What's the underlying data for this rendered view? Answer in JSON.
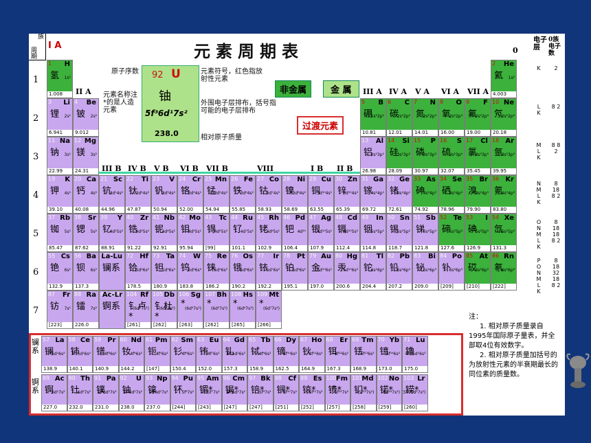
{
  "page": {
    "title": "元素周期表",
    "corner_top": "族",
    "corner_bottom": "周期",
    "group_1a": "I A",
    "group_0": "0",
    "shell_header": "电子层",
    "shell_count_header": "0族电子数"
  },
  "groups_top": [
    "II A",
    "III A",
    "IV A",
    "V A",
    "VI A",
    "VII A"
  ],
  "groups_b": [
    "III B",
    "IV B",
    "V B",
    "VI B",
    "VII B",
    "VIII",
    "I B",
    "II B"
  ],
  "periods": [
    "1",
    "2",
    "3",
    "4",
    "5",
    "6",
    "7"
  ],
  "legend": {
    "z": "92",
    "symbol": "U",
    "name": "铀",
    "config": "5f³6d¹7s²",
    "mass": "238.0",
    "label_z": "原子序数",
    "label_symbol": "元素符号，红色指放射性元素",
    "label_name": "元素名称注*的是人造元素",
    "label_config": "外围电子层排布，括号指可能的电子层排布",
    "label_mass": "相对原子质量",
    "nonmetal": "非金属",
    "metal": "金 属",
    "transition": "过渡元素"
  },
  "lanthanide_row_label": "镧系",
  "actinide_row_label": "锕系",
  "note": {
    "head": "注：",
    "line1": "1. 相对原子质量录自1995年国际原子量表，并全部取4位有效数字。",
    "line2": "2. 相对原子质量加括号的为放射性元素的半衰期最长的同位素的质量数。"
  },
  "shells": [
    {
      "letters": "K",
      "counts": "2"
    },
    {
      "letters": "L K",
      "counts": "8 2"
    },
    {
      "letters": "M L K",
      "counts": "8 8 2"
    },
    {
      "letters": "N M L K",
      "counts": "8 18 8 2"
    },
    {
      "letters": "O N M L K",
      "counts": "8 18 18 8 2"
    },
    {
      "letters": "P O N M L K",
      "counts": "8 18 32 18 8 2"
    }
  ],
  "elements": [
    {
      "z": "1",
      "s": "H",
      "n": "氢",
      "c": "1s¹",
      "m": "1.008",
      "r": 1,
      "col": 1,
      "nm": true
    },
    {
      "z": "2",
      "s": "He",
      "n": "氦",
      "c": "1s²",
      "m": "4.003",
      "r": 1,
      "col": 18,
      "nm": true
    },
    {
      "z": "3",
      "s": "Li",
      "n": "锂",
      "c": "2s¹",
      "m": "6.941",
      "r": 2,
      "col": 1
    },
    {
      "z": "4",
      "s": "Be",
      "n": "铍",
      "c": "2s²",
      "m": "9.012",
      "r": 2,
      "col": 2
    },
    {
      "z": "5",
      "s": "B",
      "n": "硼",
      "c": "2s²2p¹",
      "m": "10.81",
      "r": 2,
      "col": 13,
      "nm": true
    },
    {
      "z": "6",
      "s": "C",
      "n": "碳",
      "c": "2s²2p²",
      "m": "12.01",
      "r": 2,
      "col": 14,
      "nm": true
    },
    {
      "z": "7",
      "s": "N",
      "n": "氮",
      "c": "2s²2p³",
      "m": "14.01",
      "r": 2,
      "col": 15,
      "nm": true
    },
    {
      "z": "8",
      "s": "O",
      "n": "氧",
      "c": "2s²2p⁴",
      "m": "16.00",
      "r": 2,
      "col": 16,
      "nm": true
    },
    {
      "z": "9",
      "s": "F",
      "n": "氟",
      "c": "2s²2p⁵",
      "m": "19.00",
      "r": 2,
      "col": 17,
      "nm": true
    },
    {
      "z": "10",
      "s": "Ne",
      "n": "氖",
      "c": "2s²2p⁶",
      "m": "20.18",
      "r": 2,
      "col": 18,
      "nm": true
    },
    {
      "z": "11",
      "s": "Na",
      "n": "钠",
      "c": "3s¹",
      "m": "22.99",
      "r": 3,
      "col": 1
    },
    {
      "z": "12",
      "s": "Mg",
      "n": "镁",
      "c": "3s²",
      "m": "24.31",
      "r": 3,
      "col": 2
    },
    {
      "z": "13",
      "s": "Al",
      "n": "铝",
      "c": "3s²3p¹",
      "m": "26.98",
      "r": 3,
      "col": 13
    },
    {
      "z": "14",
      "s": "Si",
      "n": "硅",
      "c": "3s²3p²",
      "m": "28.09",
      "r": 3,
      "col": 14,
      "nm": true
    },
    {
      "z": "15",
      "s": "P",
      "n": "磷",
      "c": "3s²3p³",
      "m": "30.97",
      "r": 3,
      "col": 15,
      "nm": true
    },
    {
      "z": "16",
      "s": "S",
      "n": "硫",
      "c": "3s²3p⁴",
      "m": "32.07",
      "r": 3,
      "col": 16,
      "nm": true
    },
    {
      "z": "17",
      "s": "Cl",
      "n": "氯",
      "c": "3s²3p⁵",
      "m": "35.45",
      "r": 3,
      "col": 17,
      "nm": true
    },
    {
      "z": "18",
      "s": "Ar",
      "n": "氩",
      "c": "3s²3p⁶",
      "m": "39.95",
      "r": 3,
      "col": 18,
      "nm": true
    },
    {
      "z": "19",
      "s": "K",
      "n": "钾",
      "c": "4s¹",
      "m": "39.10",
      "r": 4,
      "col": 1
    },
    {
      "z": "20",
      "s": "Ca",
      "n": "钙",
      "c": "4s²",
      "m": "40.08",
      "r": 4,
      "col": 2
    },
    {
      "z": "21",
      "s": "Sc",
      "n": "钪",
      "c": "3d¹4s²",
      "m": "44.96",
      "r": 4,
      "col": 3
    },
    {
      "z": "22",
      "s": "Ti",
      "n": "钛",
      "c": "3d²4s²",
      "m": "47.87",
      "r": 4,
      "col": 4
    },
    {
      "z": "23",
      "s": "V",
      "n": "钒",
      "c": "3d³4s²",
      "m": "50.94",
      "r": 4,
      "col": 5
    },
    {
      "z": "24",
      "s": "Cr",
      "n": "铬",
      "c": "3d⁵4s¹",
      "m": "52.00",
      "r": 4,
      "col": 6
    },
    {
      "z": "25",
      "s": "Mn",
      "n": "锰",
      "c": "3d⁵4s²",
      "m": "54.94",
      "r": 4,
      "col": 7
    },
    {
      "z": "26",
      "s": "Fe",
      "n": "铁",
      "c": "3d⁶4s²",
      "m": "55.85",
      "r": 4,
      "col": 8
    },
    {
      "z": "27",
      "s": "Co",
      "n": "钴",
      "c": "3d⁷4s²",
      "m": "58.93",
      "r": 4,
      "col": 9
    },
    {
      "z": "28",
      "s": "Ni",
      "n": "镍",
      "c": "3d⁸4s²",
      "m": "58.69",
      "r": 4,
      "col": 10
    },
    {
      "z": "29",
      "s": "Cu",
      "n": "铜",
      "c": "3d¹⁰4s¹",
      "m": "63.55",
      "r": 4,
      "col": 11
    },
    {
      "z": "30",
      "s": "Zn",
      "n": "锌",
      "c": "3d¹⁰4s²",
      "m": "65.39",
      "r": 4,
      "col": 12
    },
    {
      "z": "31",
      "s": "Ga",
      "n": "镓",
      "c": "4s²4p¹",
      "m": "69.72",
      "r": 4,
      "col": 13
    },
    {
      "z": "32",
      "s": "Ge",
      "n": "锗",
      "c": "4s²4p²",
      "m": "72.61",
      "r": 4,
      "col": 14
    },
    {
      "z": "33",
      "s": "As",
      "n": "砷",
      "c": "4s²4p³",
      "m": "74.92",
      "r": 4,
      "col": 15,
      "nm": true
    },
    {
      "z": "34",
      "s": "Se",
      "n": "硒",
      "c": "4s²4p⁴",
      "m": "78.96",
      "r": 4,
      "col": 16,
      "nm": true
    },
    {
      "z": "35",
      "s": "Br",
      "n": "溴",
      "c": "4s²4p⁵",
      "m": "79.90",
      "r": 4,
      "col": 17,
      "nm": true
    },
    {
      "z": "36",
      "s": "Kr",
      "n": "氪",
      "c": "4s²4p⁶",
      "m": "83.80",
      "r": 4,
      "col": 18,
      "nm": true
    },
    {
      "z": "37",
      "s": "Rb",
      "n": "铷",
      "c": "5s¹",
      "m": "85.47",
      "r": 5,
      "col": 1
    },
    {
      "z": "38",
      "s": "Sr",
      "n": "锶",
      "c": "5s²",
      "m": "87.62",
      "r": 5,
      "col": 2
    },
    {
      "z": "39",
      "s": "Y",
      "n": "钇",
      "c": "4d¹5s²",
      "m": "88.91",
      "r": 5,
      "col": 3
    },
    {
      "z": "40",
      "s": "Zr",
      "n": "锆",
      "c": "4d²5s²",
      "m": "91.22",
      "r": 5,
      "col": 4
    },
    {
      "z": "41",
      "s": "Nb",
      "n": "铌",
      "c": "4d⁴5s¹",
      "m": "92.91",
      "r": 5,
      "col": 5
    },
    {
      "z": "42",
      "s": "Mo",
      "n": "钼",
      "c": "4d⁵5s¹",
      "m": "95.94",
      "r": 5,
      "col": 6
    },
    {
      "z": "43",
      "s": "Tc",
      "n": "锝",
      "c": "4d⁵5s²",
      "m": "[99]",
      "r": 5,
      "col": 7
    },
    {
      "z": "44",
      "s": "Ru",
      "n": "钌",
      "c": "4d⁷5s¹",
      "m": "101.1",
      "r": 5,
      "col": 8
    },
    {
      "z": "45",
      "s": "Rh",
      "n": "铑",
      "c": "4d⁸5s¹",
      "m": "102.9",
      "r": 5,
      "col": 9
    },
    {
      "z": "46",
      "s": "Pd",
      "n": "钯",
      "c": "4d¹⁰",
      "m": "106.4",
      "r": 5,
      "col": 10
    },
    {
      "z": "47",
      "s": "Ag",
      "n": "银",
      "c": "4d¹⁰5s¹",
      "m": "107.9",
      "r": 5,
      "col": 11
    },
    {
      "z": "48",
      "s": "Cd",
      "n": "镉",
      "c": "4d¹⁰5s²",
      "m": "112.4",
      "r": 5,
      "col": 12
    },
    {
      "z": "49",
      "s": "In",
      "n": "铟",
      "c": "5s²5p¹",
      "m": "114.8",
      "r": 5,
      "col": 13
    },
    {
      "z": "50",
      "s": "Sn",
      "n": "锡",
      "c": "5s²5p²",
      "m": "118.7",
      "r": 5,
      "col": 14
    },
    {
      "z": "51",
      "s": "Sb",
      "n": "锑",
      "c": "5s²5p³",
      "m": "121.8",
      "r": 5,
      "col": 15
    },
    {
      "z": "52",
      "s": "Te",
      "n": "碲",
      "c": "5s²5p⁴",
      "m": "127.6",
      "r": 5,
      "col": 16,
      "nm": true
    },
    {
      "z": "53",
      "s": "I",
      "n": "碘",
      "c": "5s²5p⁵",
      "m": "126.9",
      "r": 5,
      "col": 17,
      "nm": true
    },
    {
      "z": "54",
      "s": "Xe",
      "n": "氙",
      "c": "5s²5p⁶",
      "m": "131.3",
      "r": 5,
      "col": 18,
      "nm": true
    },
    {
      "z": "55",
      "s": "Cs",
      "n": "铯",
      "c": "6s¹",
      "m": "132.9",
      "r": 6,
      "col": 1
    },
    {
      "z": "56",
      "s": "Ba",
      "n": "钡",
      "c": "6s²",
      "m": "137.3",
      "r": 6,
      "col": 2
    },
    {
      "z": "57-71",
      "s": "La-Lu",
      "n": "镧系",
      "c": "",
      "m": "",
      "r": 6,
      "col": 3
    },
    {
      "z": "72",
      "s": "Hf",
      "n": "铪",
      "c": "5d²6s²",
      "m": "178.5",
      "r": 6,
      "col": 4
    },
    {
      "z": "73",
      "s": "Ta",
      "n": "钽",
      "c": "5d³6s²",
      "m": "180.9",
      "r": 6,
      "col": 5
    },
    {
      "z": "74",
      "s": "W",
      "n": "钨",
      "c": "5d⁴6s²",
      "m": "183.8",
      "r": 6,
      "col": 6
    },
    {
      "z": "75",
      "s": "Re",
      "n": "铼",
      "c": "5d⁵6s²",
      "m": "186.2",
      "r": 6,
      "col": 7
    },
    {
      "z": "76",
      "s": "Os",
      "n": "锇",
      "c": "5d⁶6s²",
      "m": "190.2",
      "r": 6,
      "col": 8
    },
    {
      "z": "77",
      "s": "Ir",
      "n": "铱",
      "c": "5d⁷6s²",
      "m": "192.2",
      "r": 6,
      "col": 9
    },
    {
      "z": "78",
      "s": "Pt",
      "n": "铂",
      "c": "5d⁹6s¹",
      "m": "195.1",
      "r": 6,
      "col": 10
    },
    {
      "z": "79",
      "s": "Au",
      "n": "金",
      "c": "5d¹⁰6s¹",
      "m": "197.0",
      "r": 6,
      "col": 11
    },
    {
      "z": "80",
      "s": "Hg",
      "n": "汞",
      "c": "5d¹⁰6s²",
      "m": "200.6",
      "r": 6,
      "col": 12
    },
    {
      "z": "81",
      "s": "Tl",
      "n": "铊",
      "c": "6s²6p¹",
      "m": "204.4",
      "r": 6,
      "col": 13
    },
    {
      "z": "82",
      "s": "Pb",
      "n": "铅",
      "c": "6s²6p²",
      "m": "207.2",
      "r": 6,
      "col": 14
    },
    {
      "z": "83",
      "s": "Bi",
      "n": "铋",
      "c": "6s²6p³",
      "m": "209.0",
      "r": 6,
      "col": 15
    },
    {
      "z": "84",
      "s": "Po",
      "n": "钋",
      "c": "6s²6p⁴",
      "m": "[209]",
      "r": 6,
      "col": 16
    },
    {
      "z": "85",
      "s": "At",
      "n": "砹",
      "c": "6s²6p⁵",
      "m": "[210]",
      "r": 6,
      "col": 17,
      "nm": true
    },
    {
      "z": "86",
      "s": "Rn",
      "n": "氡",
      "c": "6s²6p⁶",
      "m": "[222]",
      "r": 6,
      "col": 18,
      "nm": true
    },
    {
      "z": "87",
      "s": "Fr",
      "n": "钫",
      "c": "7s¹",
      "m": "[223]",
      "r": 7,
      "col": 1
    },
    {
      "z": "88",
      "s": "Ra",
      "n": "镭",
      "c": "7s²",
      "m": "226.0",
      "r": 7,
      "col": 2
    },
    {
      "z": "89-103",
      "s": "Ac-Lr",
      "n": "锕系",
      "c": "",
      "m": "",
      "r": 7,
      "col": 3
    },
    {
      "z": "104",
      "s": "Rf",
      "n": "钅卢*",
      "c": "(6d²7s²)",
      "m": "[261]",
      "r": 7,
      "col": 4
    },
    {
      "z": "105",
      "s": "Db",
      "n": "钅杜*",
      "c": "(6d³7s²)",
      "m": "[262]",
      "r": 7,
      "col": 5
    },
    {
      "z": "106",
      "s": "Sg",
      "n": "*",
      "c": "(6d⁴7s²)",
      "m": "[263]",
      "r": 7,
      "col": 6
    },
    {
      "z": "107",
      "s": "Bh",
      "n": "*",
      "c": "(6d⁵7s²)",
      "m": "[262]",
      "r": 7,
      "col": 7
    },
    {
      "z": "108",
      "s": "Hs",
      "n": "*",
      "c": "(6d⁶7s²)",
      "m": "[265]",
      "r": 7,
      "col": 8
    },
    {
      "z": "109",
      "s": "Mt",
      "n": "*",
      "c": "(6d⁷7s²)",
      "m": "[266]",
      "r": 7,
      "col": 9
    }
  ],
  "lanthanides": [
    {
      "z": "57",
      "s": "La",
      "n": "镧",
      "c": "5d¹6s²",
      "m": "138.9"
    },
    {
      "z": "58",
      "s": "Ce",
      "n": "铈",
      "c": "4f¹5d¹6s²",
      "m": "140.1"
    },
    {
      "z": "59",
      "s": "Pr",
      "n": "镨",
      "c": "4f³6s²",
      "m": "140.9"
    },
    {
      "z": "60",
      "s": "Nd",
      "n": "钕",
      "c": "4f⁴6s²",
      "m": "144.2"
    },
    {
      "z": "61",
      "s": "Pm",
      "n": "钷",
      "c": "4f⁵6s²",
      "m": "[147]"
    },
    {
      "z": "62",
      "s": "Sm",
      "n": "钐",
      "c": "4f⁶6s²",
      "m": "150.4"
    },
    {
      "z": "63",
      "s": "Eu",
      "n": "铕",
      "c": "4f⁷6s²",
      "m": "152.0"
    },
    {
      "z": "64",
      "s": "Gd",
      "n": "钆",
      "c": "4f⁷5d¹6s²",
      "m": "157.3"
    },
    {
      "z": "65",
      "s": "Tb",
      "n": "铽",
      "c": "4f⁹6s²",
      "m": "158.9"
    },
    {
      "z": "66",
      "s": "Dy",
      "n": "镝",
      "c": "4f¹⁰6s²",
      "m": "162.5"
    },
    {
      "z": "67",
      "s": "Ho",
      "n": "钬",
      "c": "4f¹¹6s²",
      "m": "164.9"
    },
    {
      "z": "68",
      "s": "Er",
      "n": "铒",
      "c": "4f¹²6s²",
      "m": "167.3"
    },
    {
      "z": "69",
      "s": "Tm",
      "n": "铥",
      "c": "4f¹³6s²",
      "m": "168.9"
    },
    {
      "z": "70",
      "s": "Yb",
      "n": "镱",
      "c": "4f¹⁴6s²",
      "m": "173.0"
    },
    {
      "z": "71",
      "s": "Lu",
      "n": "镥",
      "c": "4f¹⁴5d¹6s²",
      "m": "175.0"
    }
  ],
  "actinides": [
    {
      "z": "89",
      "s": "Ac",
      "n": "锕",
      "c": "6d¹7s²",
      "m": "227.0"
    },
    {
      "z": "90",
      "s": "Th",
      "n": "钍",
      "c": "6d²7s²",
      "m": "232.0"
    },
    {
      "z": "91",
      "s": "Pa",
      "n": "镤",
      "c": "5f²6d¹7s²",
      "m": "231.0"
    },
    {
      "z": "92",
      "s": "U",
      "n": "铀",
      "c": "5f³6d¹7s²",
      "m": "238.0"
    },
    {
      "z": "93",
      "s": "Np",
      "n": "镎",
      "c": "5f⁴6d¹7s²",
      "m": "237.0"
    },
    {
      "z": "94",
      "s": "Pu",
      "n": "钚",
      "c": "5f⁶7s²",
      "m": "[244]"
    },
    {
      "z": "95",
      "s": "Am",
      "n": "镅*",
      "c": "5f⁷7s²",
      "m": "[243]"
    },
    {
      "z": "96",
      "s": "Cm",
      "n": "锔*",
      "c": "5f⁷6d¹7s²",
      "m": "[247]"
    },
    {
      "z": "97",
      "s": "Bk",
      "n": "锫*",
      "c": "5f⁹7s²",
      "m": "[247]"
    },
    {
      "z": "98",
      "s": "Cf",
      "n": "锎*",
      "c": "5f¹⁰7s²",
      "m": "[251]"
    },
    {
      "z": "99",
      "s": "Es",
      "n": "锿*",
      "c": "5f¹¹7s²",
      "m": "[252]"
    },
    {
      "z": "100",
      "s": "Fm",
      "n": "镄*",
      "c": "5f¹²7s²",
      "m": "[257]"
    },
    {
      "z": "101",
      "s": "Md",
      "n": "钔*",
      "c": "(5f¹³7s²)",
      "m": "[258]"
    },
    {
      "z": "102",
      "s": "No",
      "n": "锘*",
      "c": "(5f¹⁴7s²)",
      "m": "[259]"
    },
    {
      "z": "103",
      "s": "Lr",
      "n": "铹*",
      "c": "(5f¹⁴6d¹7s²)",
      "m": "[260]"
    }
  ]
}
